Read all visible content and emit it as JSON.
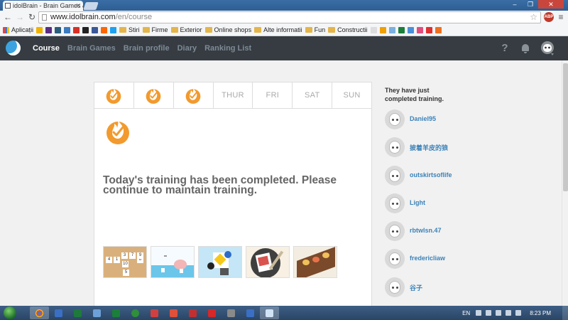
{
  "browser": {
    "tab_title": "idolBrain - Brain Games &",
    "url_host": "www.idolbrain.com",
    "url_path": "/en/course",
    "bookmarks": [
      {
        "label": "Aplicații",
        "kind": "apps"
      },
      {
        "label": "",
        "kind": "icon",
        "color": "#f0b400"
      },
      {
        "label": "",
        "kind": "icon",
        "color": "#5a2d82"
      },
      {
        "label": "",
        "kind": "icon",
        "color": "#2b5d7c"
      },
      {
        "label": "",
        "kind": "icon",
        "color": "#3b7bbf"
      },
      {
        "label": "",
        "kind": "icon",
        "color": "#d93025"
      },
      {
        "label": "",
        "kind": "icon",
        "color": "#222222"
      },
      {
        "label": "",
        "kind": "icon",
        "color": "#3b5998"
      },
      {
        "label": "",
        "kind": "icon",
        "color": "#ff6600"
      },
      {
        "label": "",
        "kind": "icon",
        "color": "#1da1f2"
      },
      {
        "label": "Stiri",
        "kind": "folder"
      },
      {
        "label": "Firme",
        "kind": "folder"
      },
      {
        "label": "Exterior",
        "kind": "folder"
      },
      {
        "label": "Online shops",
        "kind": "folder"
      },
      {
        "label": "Alte informatii",
        "kind": "folder"
      },
      {
        "label": "Fun",
        "kind": "folder"
      },
      {
        "label": "Constructii",
        "kind": "folder"
      },
      {
        "label": "",
        "kind": "icon",
        "color": "#dddddd"
      },
      {
        "label": "",
        "kind": "icon",
        "color": "#f0a000"
      },
      {
        "label": "",
        "kind": "icon",
        "color": "#7bb0e0"
      },
      {
        "label": "",
        "kind": "icon",
        "color": "#1b7f3a"
      },
      {
        "label": "",
        "kind": "icon",
        "color": "#4a90d9"
      },
      {
        "label": "",
        "kind": "icon",
        "color": "#e04e7e"
      },
      {
        "label": "",
        "kind": "icon",
        "color": "#e03030"
      },
      {
        "label": "",
        "kind": "icon",
        "color": "#f07020"
      }
    ]
  },
  "site": {
    "nav": [
      "Course",
      "Brain Games",
      "Brain profile",
      "Diary",
      "Ranking List"
    ],
    "active_nav": "Course",
    "help_label": "?"
  },
  "week": {
    "days": [
      {
        "label": "",
        "completed": true
      },
      {
        "label": "",
        "completed": true
      },
      {
        "label": "",
        "completed": true
      },
      {
        "label": "THUR",
        "completed": false
      },
      {
        "label": "FRI",
        "completed": false
      },
      {
        "label": "SAT",
        "completed": false
      },
      {
        "label": "SUN",
        "completed": false
      }
    ]
  },
  "main": {
    "message": "Today's training has been completed. Please continue to maintain training.",
    "games": [
      "numbers-game",
      "bird-game",
      "shapes-game",
      "paper-game",
      "path-game"
    ],
    "number_tiles": [
      "4",
      "1",
      "3",
      "7",
      "8",
      "9",
      "10",
      "5"
    ]
  },
  "sidebar": {
    "title": "They have just completed training.",
    "users": [
      "Daniel95",
      "披着羊皮的狼",
      "outskirtsoflife",
      "Light",
      "rbtwlsn.47",
      "fredericliaw",
      "谷子"
    ]
  },
  "taskbar": {
    "lang": "EN",
    "time": "8:23 PM"
  },
  "colors": {
    "flame": "#f29a2e",
    "nav_bg": "#363c42",
    "link": "#3b82b8"
  }
}
